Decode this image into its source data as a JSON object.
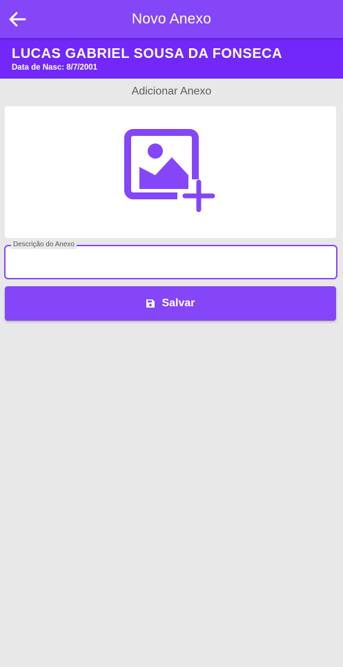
{
  "app_bar": {
    "title": "Novo Anexo",
    "back_icon": "arrow-left-icon"
  },
  "patient": {
    "name": "LUCAS GABRIEL SOUSA DA FONSECA",
    "dob_label": "Data de Nasc:",
    "dob_value": "8/7/2001"
  },
  "attachment": {
    "section_title": "Adicionar Anexo",
    "image_icon": "add-photo-icon"
  },
  "description_field": {
    "label": "Descrição do Anexo",
    "value": ""
  },
  "save_button": {
    "label": "Salvar",
    "icon": "save-icon"
  },
  "colors": {
    "app_bar": "#8446f7",
    "patient_header": "#7128f8",
    "accent": "#8446f7",
    "background": "#e8e8e8"
  }
}
